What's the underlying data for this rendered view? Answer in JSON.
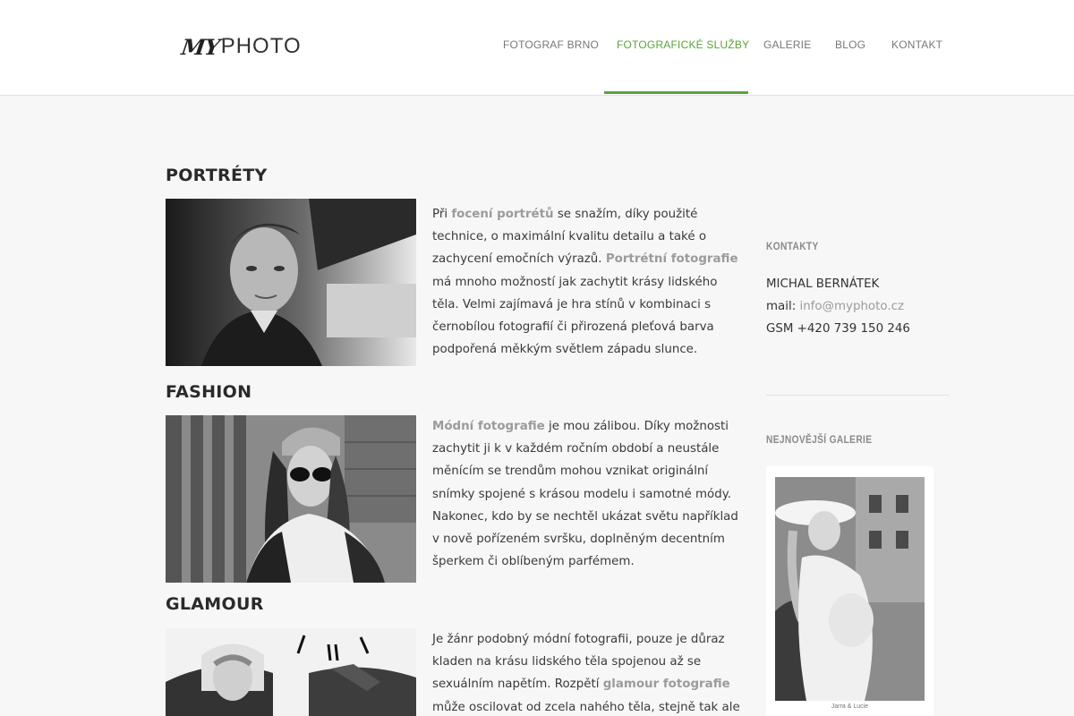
{
  "header": {
    "logo_my": "MY",
    "logo_photo": "PHOTO",
    "nav": [
      {
        "label": "FOTOGRAF BRNO",
        "active": false
      },
      {
        "label": "FOTOGRAFICKÉ SLUŽBY",
        "active": true
      },
      {
        "label": "GALERIE",
        "active": false
      },
      {
        "label": "BLOG",
        "active": false
      },
      {
        "label": "KONTAKT",
        "active": false
      }
    ]
  },
  "sections": [
    {
      "title": "PORTRÉTY",
      "text": [
        {
          "t": "Při "
        },
        {
          "t": "focení portrétů",
          "link": true
        },
        {
          "t": " se snažím, díky použité technice, o maximální kvalitu detailu a také o zachycení emočních výrazů. "
        },
        {
          "t": "Portrétní fotografie",
          "link": true
        },
        {
          "t": " má mnoho možností jak zachytit krásy lidského těla. Velmi zajímavá je hra stínů v kombinaci s černobílou fotografií či přirozená pleťová barva podpořená měkkým světlem západu slunce."
        }
      ]
    },
    {
      "title": "FASHION",
      "text": [
        {
          "t": "Módní fotografie",
          "link": true
        },
        {
          "t": " je mou zálibou. Díky možnosti zachytit ji k v každém ročním období a neustále měnícím se trendům mohou vznikat originální snímky spojené s krásou modelu i samotné módy. Nakonec,  kdo by se nechtěl ukázat světu například v nově pořízeném svršku, doplněným decentním  šperkem či  oblíbeným parfémem."
        }
      ]
    },
    {
      "title": "GLAMOUR",
      "text": [
        {
          "t": "Je žánr podobný módní fotografii, pouze je důraz kladen na krásu lidského těla spojenou až se sexuálním napětím. Rozpětí "
        },
        {
          "t": "glamour fotografie",
          "link": true
        },
        {
          "t": " může oscilovat od  zcela nahého těla, stejně tak ale"
        }
      ]
    }
  ],
  "sidebar": {
    "contacts_heading": "KONTAKTY",
    "name": "MICHAL BERNÁTEK",
    "mail_label": "mail: ",
    "mail_value": "info@myphoto.cz",
    "gsm": "GSM +420 739 150 246",
    "gallery_heading": "NEJNOVĚJŠÍ GALERIE",
    "gallery_caption": "Jarra & Lucie"
  },
  "colors": {
    "accent": "#5aa43a",
    "link": "#9b9b9b",
    "header_bg": "#ffffff",
    "page_bg": "#f7f7f7"
  }
}
